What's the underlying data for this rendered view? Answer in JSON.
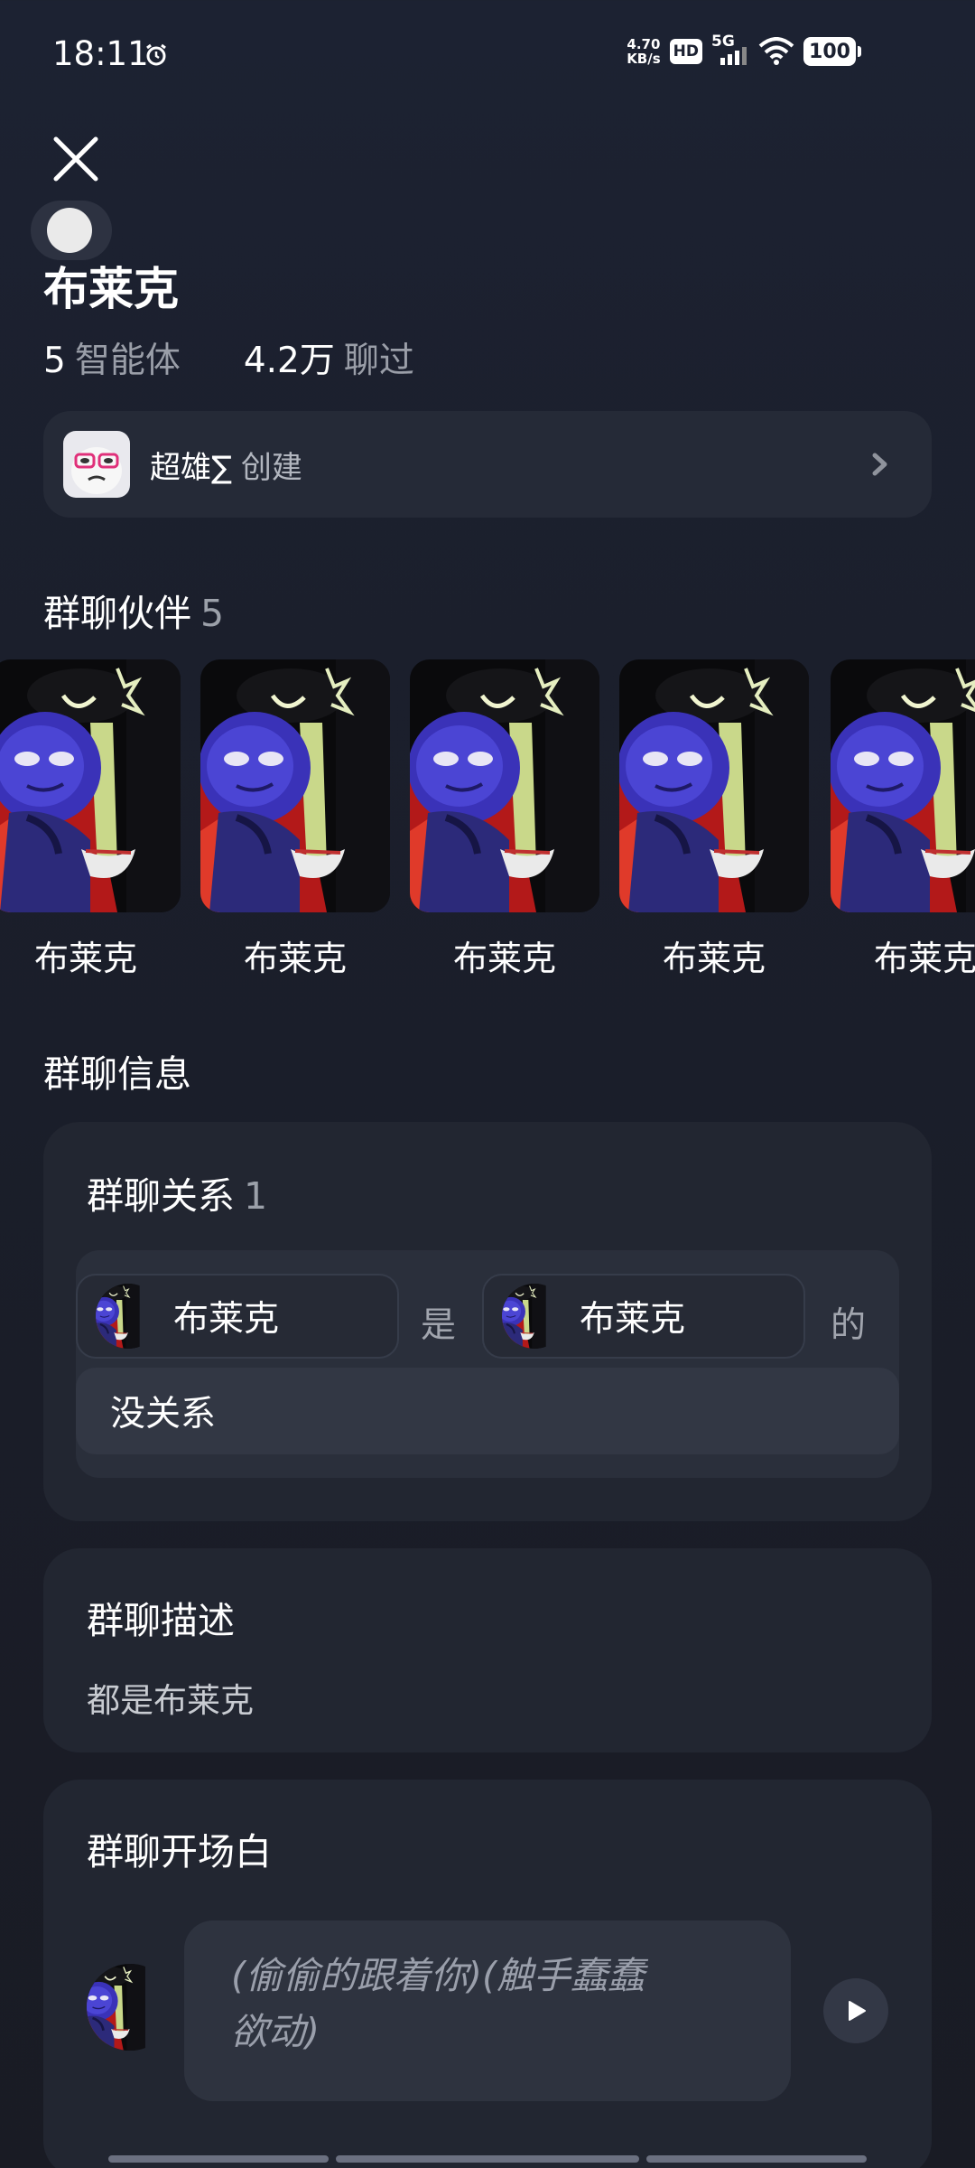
{
  "status_bar": {
    "time": "18:11",
    "net_speed_value": "4.70",
    "net_speed_unit": "KB/s",
    "hd_label": "HD",
    "network": "5G",
    "battery": "100"
  },
  "header": {
    "title": "布莱克",
    "agents_count": "5",
    "agents_label": "智能体",
    "chats_count": "4.2万",
    "chats_label": "聊过"
  },
  "creator": {
    "name": "超雄∑",
    "action": "创建"
  },
  "partners": {
    "heading": "群聊伙伴",
    "count": "5",
    "items": [
      {
        "name": "布莱克"
      },
      {
        "name": "布莱克"
      },
      {
        "name": "布莱克"
      },
      {
        "name": "布莱克"
      },
      {
        "name": "布莱克"
      }
    ]
  },
  "info": {
    "heading": "群聊信息",
    "relation": {
      "heading": "群聊关系",
      "count": "1",
      "from": "布莱克",
      "is_word": "是",
      "to": "布莱克",
      "of_word": "的",
      "relation_value": "没关系"
    },
    "description": {
      "heading": "群聊描述",
      "text": "都是布莱克"
    },
    "greeting": {
      "heading": "群聊开场白",
      "line1": "(偷偷的跟着你)(触手蠢蠢",
      "line2": "欲动)"
    }
  },
  "colors": {
    "background": "#1b1f2c",
    "card": "#222631",
    "muted_text": "#9ba0a9"
  }
}
